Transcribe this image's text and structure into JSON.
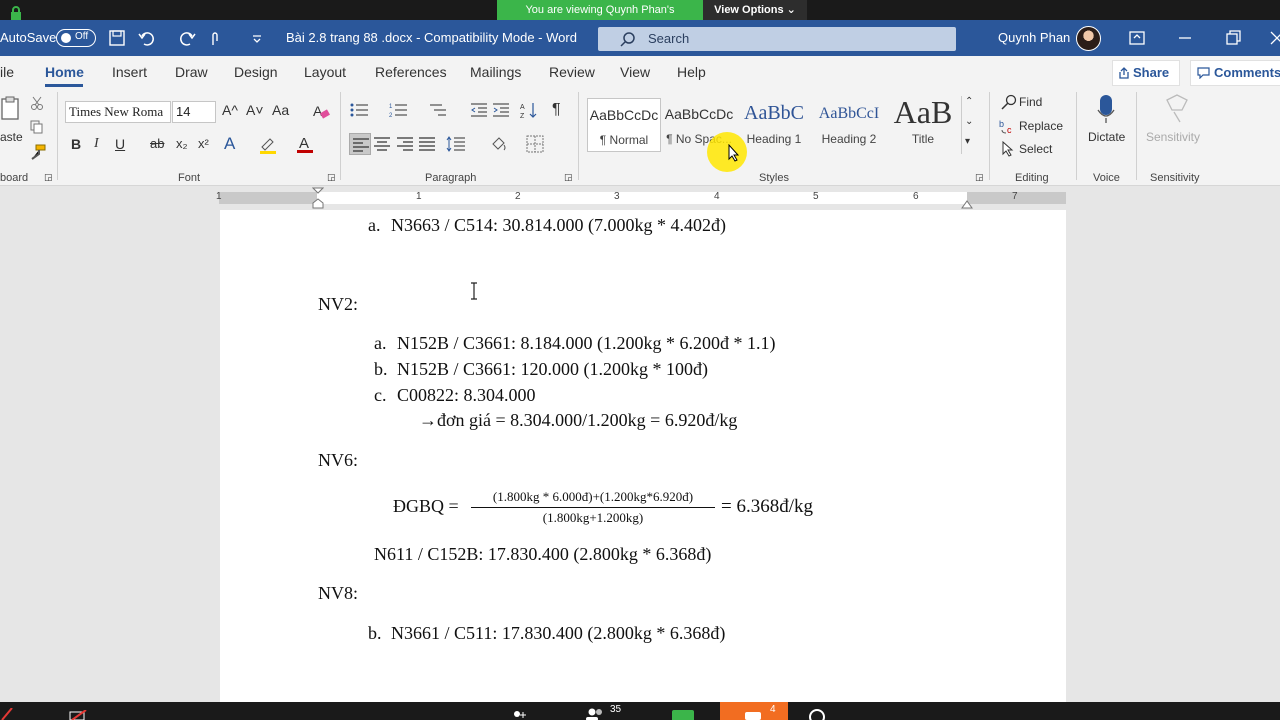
{
  "zoom": {
    "banner_text": "You are viewing Quynh Phan's screen",
    "view_options_label": "View Options ⌄"
  },
  "titlebar": {
    "autosave_label": "AutoSave",
    "autosave_state": "Off",
    "doc_title": "Bài 2.8 trang 88 .docx  -  Compatibility Mode  -  Word",
    "search_placeholder": "Search",
    "user_name": "Quynh Phan"
  },
  "tabs": [
    "ile",
    "Home",
    "Insert",
    "Draw",
    "Design",
    "Layout",
    "References",
    "Mailings",
    "Review",
    "View",
    "Help"
  ],
  "share_label": "Share",
  "comments_label": "Comments",
  "ribbon": {
    "clipboard": {
      "paste_label": "aste",
      "group_label": "board"
    },
    "font": {
      "font_name": "Times New Roma",
      "font_size": "14",
      "group_label": "Font",
      "grow": "A^",
      "shrink": "A˅",
      "case": "Aa",
      "bold": "B",
      "italic": "I",
      "underline": "U",
      "strike": "ab",
      "sub": "x₂",
      "sup": "x²",
      "effects": "A",
      "highlight_color": "#ffd800",
      "font_color": "#c00000"
    },
    "paragraph": {
      "group_label": "Paragraph",
      "pilcrow": "¶"
    },
    "styles": {
      "group_label": "Styles",
      "items": [
        {
          "preview": "AaBbCcDc",
          "name": "¶ Normal"
        },
        {
          "preview": "AaBbCcDc",
          "name": "¶ No Spac..."
        },
        {
          "preview": "AaBbC",
          "name": "Heading 1"
        },
        {
          "preview": "AaBbCcI",
          "name": "Heading 2"
        },
        {
          "preview": "AaB",
          "name": "Title"
        }
      ]
    },
    "editing": {
      "group_label": "Editing",
      "find": "Find",
      "replace": "Replace",
      "select": "Select"
    },
    "voice": {
      "group_label": "Voice",
      "dictate": "Dictate"
    },
    "sensitivity": {
      "group_label": "Sensitivity",
      "label": "Sensitivity"
    }
  },
  "ruler": {
    "numbers": [
      "1",
      "1",
      "2",
      "3",
      "4",
      "5",
      "6",
      "7"
    ]
  },
  "document": {
    "line_a_top": {
      "marker": "a.",
      "text": "N3663 / C514: 30.814.000 (7.000kg * 4.402đ)"
    },
    "nv2_heading": "NV2:",
    "nv2_items": [
      {
        "marker": "a.",
        "text": "N152B / C3661:  8.184.000 (1.200kg * 6.200đ * 1.1)"
      },
      {
        "marker": "b.",
        "text": "N152B / C3661: 120.000 (1.200kg * 100đ)"
      },
      {
        "marker": "c.",
        "text": "C00822:  8.304.000"
      }
    ],
    "unit_price_arrow": "→",
    "unit_price_line": "đơn giá = 8.304.000/1.200kg = 6.920đ/kg",
    "nv6_heading": "NV6:",
    "formula_left": "ĐGBQ =",
    "formula_numerator": "(1.800kg * 6.000đ)+(1.200kg*6.920đ)",
    "formula_denominator": "(1.800kg+1.200kg)",
    "formula_result": "= 6.368đ/kg",
    "n611_line": "N611 / C152B: 17.830.400 (2.800kg * 6.368đ)",
    "nv8_heading": "NV8:",
    "nv8_item": {
      "marker": "b.",
      "text": "N3661 / C511:  17.830.400 (2.800kg * 6.368đ)"
    }
  },
  "taskbar": {
    "participants_count": "35",
    "chat_count": "4"
  }
}
